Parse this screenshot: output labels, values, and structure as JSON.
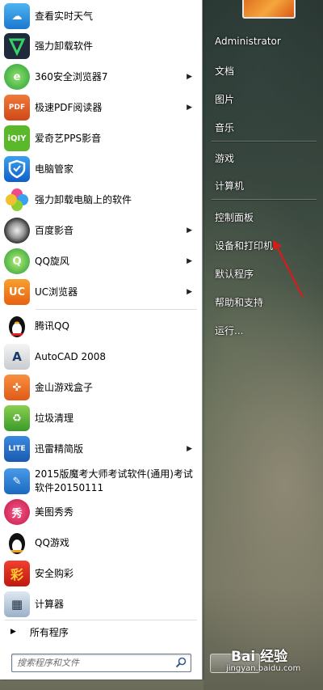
{
  "start_menu": {
    "programs": [
      {
        "label": "查看实时天气",
        "icon": "weather-icon",
        "has_arrow": false
      },
      {
        "label": "强力卸载软件",
        "icon": "uninstall-icon",
        "has_arrow": false
      },
      {
        "label": "360安全浏览器7",
        "icon": "360-browser-icon",
        "has_arrow": true
      },
      {
        "label": "极速PDF阅读器",
        "icon": "pdf-reader-icon",
        "has_arrow": true
      },
      {
        "label": "爱奇艺PPS影音",
        "icon": "iqiyi-icon",
        "has_arrow": false
      },
      {
        "label": "电脑管家",
        "icon": "pc-manager-icon",
        "has_arrow": false
      },
      {
        "label": "强力卸载电脑上的软件",
        "icon": "uninstall-flower-icon",
        "has_arrow": false
      },
      {
        "label": "百度影音",
        "icon": "baidu-player-icon",
        "has_arrow": true
      },
      {
        "label": "QQ旋风",
        "icon": "qq-whirlwind-icon",
        "has_arrow": true
      },
      {
        "label": "UC浏览器",
        "icon": "uc-browser-icon",
        "has_arrow": true
      },
      {
        "label": "腾讯QQ",
        "icon": "qq-penguin-icon",
        "has_arrow": false
      },
      {
        "label": "AutoCAD 2008",
        "icon": "autocad-icon",
        "has_arrow": false
      },
      {
        "label": "金山游戏盒子",
        "icon": "game-box-icon",
        "has_arrow": false
      },
      {
        "label": "垃圾清理",
        "icon": "trash-clean-icon",
        "has_arrow": false
      },
      {
        "label": "迅雷精简版",
        "icon": "thunder-icon",
        "has_arrow": true
      },
      {
        "label": "2015版魔考大师考试软件(通用)考试软件20150111",
        "icon": "exam-software-icon",
        "has_arrow": false
      },
      {
        "label": "美图秀秀",
        "icon": "meitu-icon",
        "has_arrow": false
      },
      {
        "label": "QQ游戏",
        "icon": "qq-game-icon",
        "has_arrow": false
      },
      {
        "label": "安全购彩",
        "icon": "lottery-icon",
        "has_arrow": false
      },
      {
        "label": "计算器",
        "icon": "calculator-icon",
        "has_arrow": false
      }
    ],
    "all_programs": "所有程序",
    "search_placeholder": "搜索程序和文件",
    "right": {
      "user": "Administrator",
      "documents": "文档",
      "pictures": "图片",
      "music": "音乐",
      "games": "游戏",
      "computer": "计算机",
      "control_panel": "控制面板",
      "devices_printers": "设备和打印机",
      "default_programs": "默认程序",
      "help_support": "帮助和支持",
      "run": "运行..."
    }
  },
  "watermark": {
    "logo": "Bai 经验",
    "url": "jingyan.baidu.com"
  },
  "colors": {
    "annotation_arrow": "#e01818",
    "search_border": "#6a7b8c"
  }
}
